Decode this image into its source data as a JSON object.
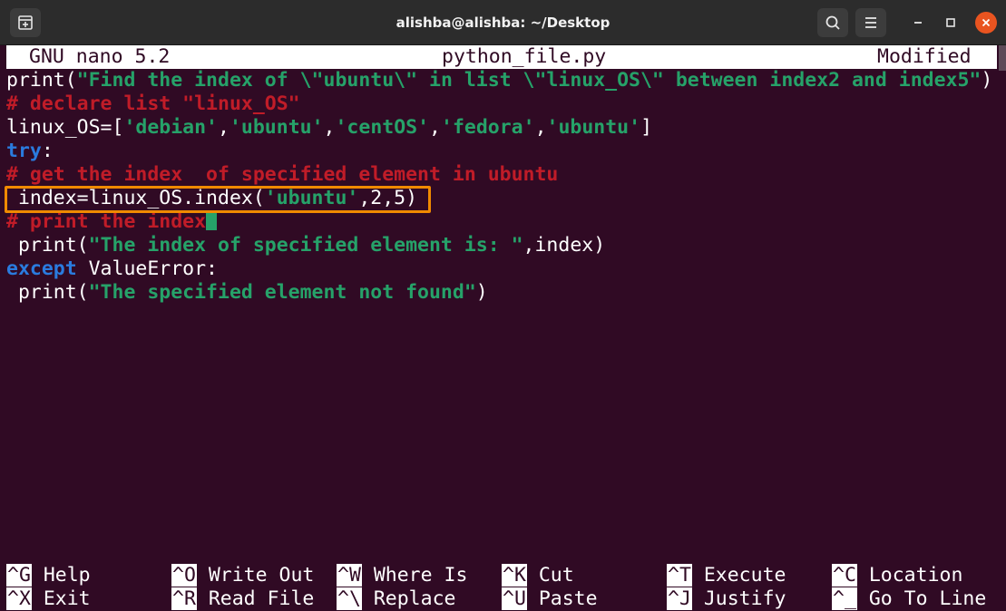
{
  "window": {
    "title": "alishba@alishba: ~/Desktop"
  },
  "titlebar_icons": {
    "new_tab": "new-tab-icon",
    "search": "search-icon",
    "menu": "hamburger-menu-icon",
    "minimize": "minimize-icon",
    "maximize": "maximize-icon",
    "close": "close-icon"
  },
  "colors": {
    "terminal_bg": "#300a24",
    "string": "#26a269",
    "keyword": "#2a7bde",
    "comment": "#c01c28",
    "highlight": "#f08a00",
    "close_button": "#e95420"
  },
  "nano": {
    "version": "GNU nano 5.2",
    "filename": "python_file.py",
    "status": "Modified"
  },
  "code": {
    "l1_a": "print(",
    "l1_b": "\"Find the index of \\\"ubuntu\\\" in list \\\"linux_OS\\\" between index2 and index5\"",
    "l1_c": ")",
    "l2": "# declare list \"linux_OS\"",
    "l3_a": "linux_OS=[",
    "l3_s1": "'debian'",
    "l3_c1": ",",
    "l3_s2": "'ubuntu'",
    "l3_c2": ",",
    "l3_s3": "'centOS'",
    "l3_c3": ",",
    "l3_s4": "'fedora'",
    "l3_c4": ",",
    "l3_s5": "'ubuntu'",
    "l3_b": "]",
    "l4_kw": "try",
    "l4_b": ":",
    "l5": "# get the index  of specified element in ubuntu",
    "l6_a": " index=linux_OS.index(",
    "l6_s": "'ubuntu'",
    "l6_b": ",2,5)",
    "l7": "# print the index",
    "l8_a": " print(",
    "l8_s": "\"The index of specified element is: \"",
    "l8_b": ",index)",
    "l9_kw": "except",
    "l9_b": " ValueError:",
    "l10_a": " print(",
    "l10_s": "\"The specified element not found\"",
    "l10_b": ")"
  },
  "shortcuts": [
    {
      "key": "^G",
      "label": "Help"
    },
    {
      "key": "^O",
      "label": "Write Out"
    },
    {
      "key": "^W",
      "label": "Where Is"
    },
    {
      "key": "^K",
      "label": "Cut"
    },
    {
      "key": "^T",
      "label": "Execute"
    },
    {
      "key": "^C",
      "label": "Location"
    },
    {
      "key": "^X",
      "label": "Exit"
    },
    {
      "key": "^R",
      "label": "Read File"
    },
    {
      "key": "^\\",
      "label": "Replace"
    },
    {
      "key": "^U",
      "label": "Paste"
    },
    {
      "key": "^J",
      "label": "Justify"
    },
    {
      "key": "^_",
      "label": "Go To Line"
    }
  ]
}
